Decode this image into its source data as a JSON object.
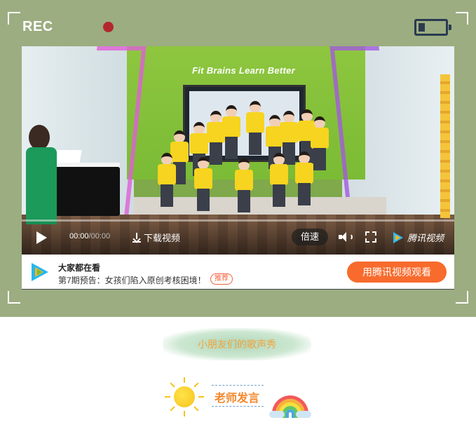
{
  "recorder": {
    "label": "REC",
    "dot_color": "#b3282d",
    "frame_color": "#9cad81",
    "battery_icon": "battery-low-icon"
  },
  "video": {
    "wall_text": "Fit Brains Learn Better",
    "current_time": "00:00",
    "duration": "/00:00",
    "download_label": "下载视频",
    "speed_label": "倍速",
    "brand_label": "腾讯视频",
    "icons": {
      "play": "play-icon",
      "download": "download-icon",
      "volume": "volume-icon",
      "fullscreen": "fullscreen-icon",
      "brand": "tencent-video-logo-icon"
    }
  },
  "recommendation": {
    "title": "大家都在看",
    "subtitle": "第7期预告：女孩们陷入原创考核困境！",
    "tag": "推荐",
    "button_label": "用腾讯视频观看",
    "button_color": "#f86b2d"
  },
  "sections": {
    "kids_title": "小朋友们的歌声秀",
    "teacher_title": "老师发言"
  }
}
